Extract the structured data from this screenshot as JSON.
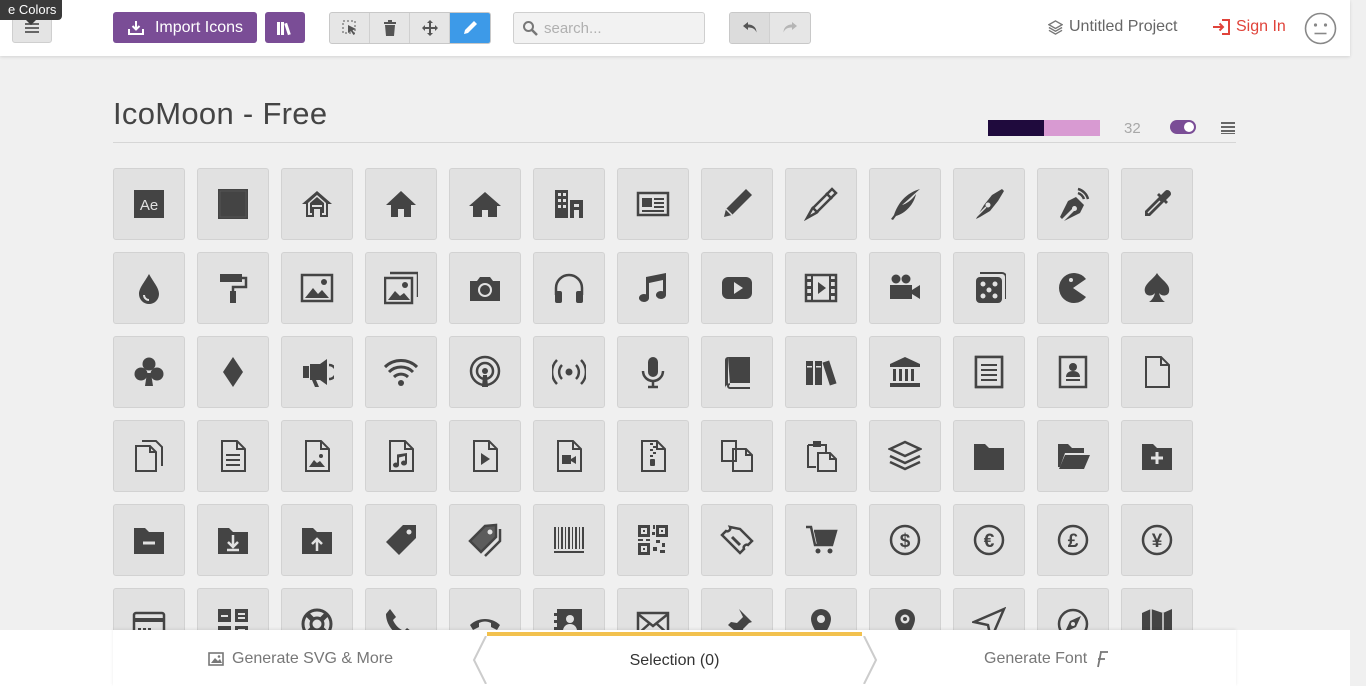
{
  "tooltip": "e Colors",
  "toolbar": {
    "import_label": "Import Icons",
    "search_placeholder": "search...",
    "project_label": "Untitled Project",
    "signin_label": "Sign In"
  },
  "set": {
    "title": "IcoMoon - Free",
    "count": "32",
    "colors": [
      "#1f0a3d",
      "#d89ad2"
    ]
  },
  "colors": {
    "accent": "#7a4d96",
    "active_tool": "#3d9ae8",
    "signin": "#e0433a",
    "tab_highlight": "#f2c14e"
  },
  "icons": [
    "adobe-ae-icon",
    "square-icon",
    "home-icon",
    "home2-icon",
    "home3-icon",
    "office-icon",
    "newspaper-icon",
    "pencil-icon",
    "pencil2-icon",
    "quill-icon",
    "pen-icon",
    "blog-icon",
    "eyedropper-icon",
    "droplet-icon",
    "paint-format-icon",
    "image-icon",
    "images-icon",
    "camera-icon",
    "headphones-icon",
    "music-icon",
    "play-icon",
    "film-icon",
    "video-camera-icon",
    "dice-icon",
    "pacman-icon",
    "spades-icon",
    "clubs-icon",
    "diamonds-icon",
    "bullhorn-icon",
    "wifi-icon",
    "podcast-icon",
    "feed-icon",
    "mic-icon",
    "book-icon",
    "books-icon",
    "library-icon",
    "file-text-icon",
    "profile-icon",
    "file-empty-icon",
    "files-empty-icon",
    "file-text2-icon",
    "file-picture-icon",
    "file-music-icon",
    "file-play-icon",
    "file-video-icon",
    "file-zip-icon",
    "copy-icon",
    "paste-icon",
    "stack-icon",
    "folder-icon",
    "folder-open-icon",
    "folder-plus-icon",
    "folder-minus-icon",
    "folder-download-icon",
    "folder-upload-icon",
    "price-tag-icon",
    "price-tags-icon",
    "barcode-icon",
    "qrcode-icon",
    "ticket-icon",
    "cart-icon",
    "coin-dollar-icon",
    "coin-euro-icon",
    "coin-pound-icon",
    "coin-yen-icon",
    "credit-card-icon",
    "calculator-icon",
    "lifebuoy-icon",
    "phone-icon",
    "phone-hang-up-icon",
    "address-book-icon",
    "envelop-icon",
    "pushpin-icon",
    "location-icon",
    "location2-icon",
    "compass-icon",
    "compass2-icon",
    "map-icon"
  ],
  "bottom": {
    "generate_svg": "Generate SVG & More",
    "selection": "Selection (0)",
    "generate_font": "Generate Font"
  }
}
